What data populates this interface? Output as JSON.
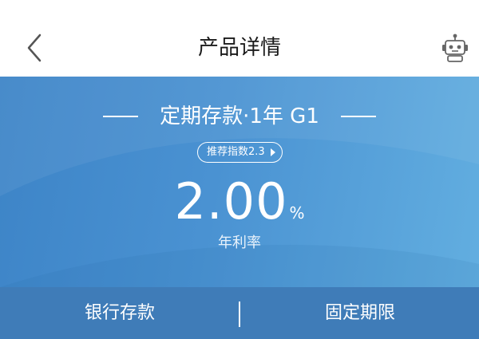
{
  "header": {
    "title": "产品详情",
    "back_icon": "chevron-left-icon",
    "assistant_icon": "robot-icon"
  },
  "product": {
    "name": "定期存款·1年 G1",
    "recommend_label": "推荐指数2.3",
    "rate_value": "2.00",
    "rate_unit": "%",
    "rate_caption": "年利率"
  },
  "tags": [
    "银行存款",
    "固定期限"
  ],
  "colors": {
    "hero_start": "#3d84c7",
    "hero_end": "#62aee0",
    "tagbar": "#3f7cb8",
    "text_on_blue": "#ffffff"
  }
}
